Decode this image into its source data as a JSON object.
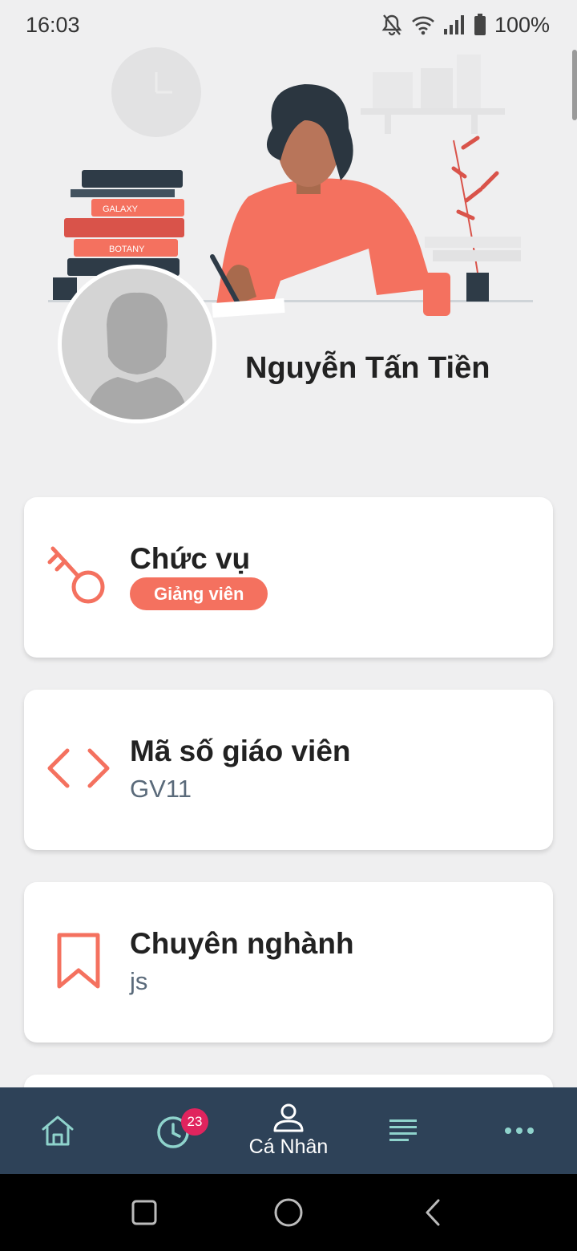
{
  "status_bar": {
    "time": "16:03",
    "battery": "100%",
    "icons": [
      "mute-icon",
      "wifi-icon",
      "signal-icon",
      "battery-icon"
    ]
  },
  "profile": {
    "name": "Nguyễn Tấn Tiền"
  },
  "illustration_text": {
    "book_1": "GALAXY",
    "book_2": "BOTANY"
  },
  "cards": [
    {
      "title": "Chức vụ",
      "value": "Giảng viên",
      "icon": "key-icon"
    },
    {
      "title": "Mã số giáo viên",
      "value": "GV11",
      "icon": "code-icon"
    },
    {
      "title": "Chuyên nghành",
      "value": "js",
      "icon": "bookmark-icon"
    }
  ],
  "bottom_nav": {
    "items": [
      {
        "icon": "home-icon",
        "label": ""
      },
      {
        "icon": "clock-icon",
        "label": "",
        "badge": "23"
      },
      {
        "icon": "person-icon",
        "label": "Cá Nhân"
      },
      {
        "icon": "list-icon",
        "label": ""
      },
      {
        "icon": "more-icon",
        "label": ""
      }
    ],
    "active_index": 2
  },
  "system_nav": [
    "recents-icon",
    "home-circle-icon",
    "back-icon"
  ],
  "colors": {
    "accent": "#f4715f",
    "nav_bg": "#2e4258",
    "page_bg": "#efeff0",
    "badge": "#e0245e",
    "nav_icon": "#8fd3cc"
  }
}
